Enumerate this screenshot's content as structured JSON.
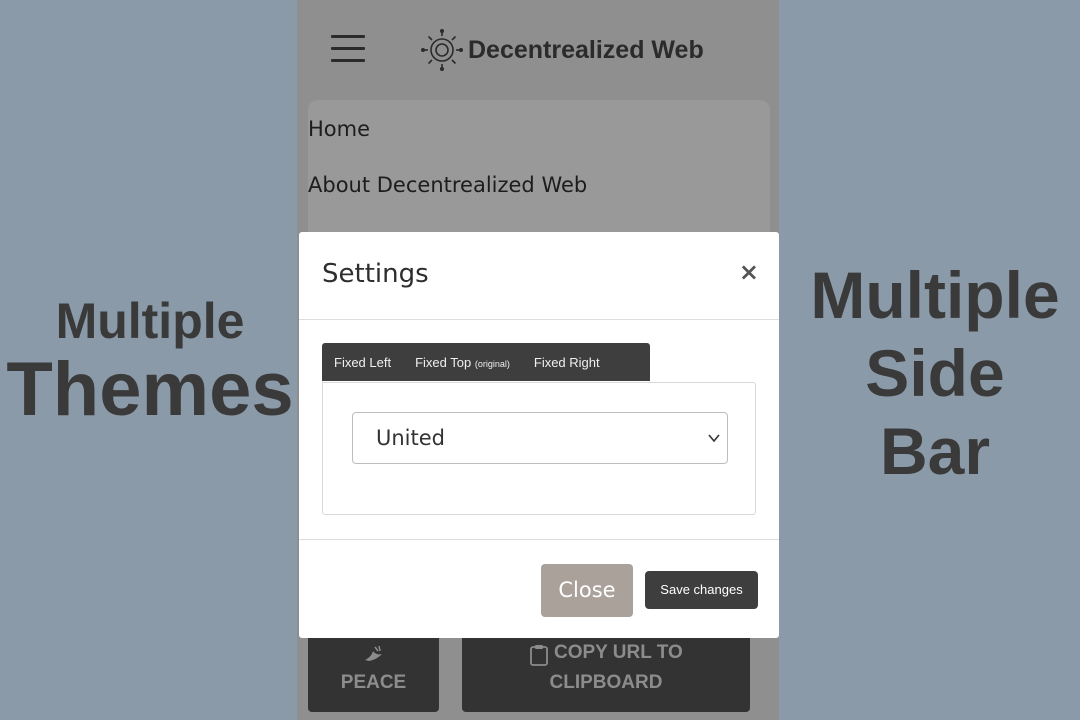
{
  "promo": {
    "left_line1": "Multiple",
    "left_line2": "Themes",
    "right_line1": "Multiple",
    "right_line2": "Side",
    "right_line3": "Bar"
  },
  "app": {
    "brand_icon": "sun-icon",
    "title": "Decentrealized Web",
    "menu_icon": "hamburger-menu-icon"
  },
  "nav": {
    "items": [
      {
        "label": "Home"
      },
      {
        "label": "About Decentrealized Web"
      }
    ]
  },
  "bottom_buttons": {
    "peace_icon": "dove-icon",
    "peace_label": "PEACE",
    "copy_icon": "clipboard-icon",
    "copy_line1": "COPY URL TO",
    "copy_line2": "CLIPBOARD"
  },
  "modal": {
    "title": "Settings",
    "close_symbol": "×",
    "tabs": [
      {
        "label": "Fixed Left"
      },
      {
        "label": "Fixed Top",
        "note": "(original)"
      },
      {
        "label": "Fixed Right"
      }
    ],
    "select_value": "United",
    "close_button": "Close",
    "save_button": "Save changes"
  },
  "colors": {
    "page_background": "#8b9aa8",
    "overlay": "#8f8f8f",
    "tab_bar": "#3e3e3e",
    "close_button": "#aaa19a",
    "save_button": "#3e3e3e"
  }
}
